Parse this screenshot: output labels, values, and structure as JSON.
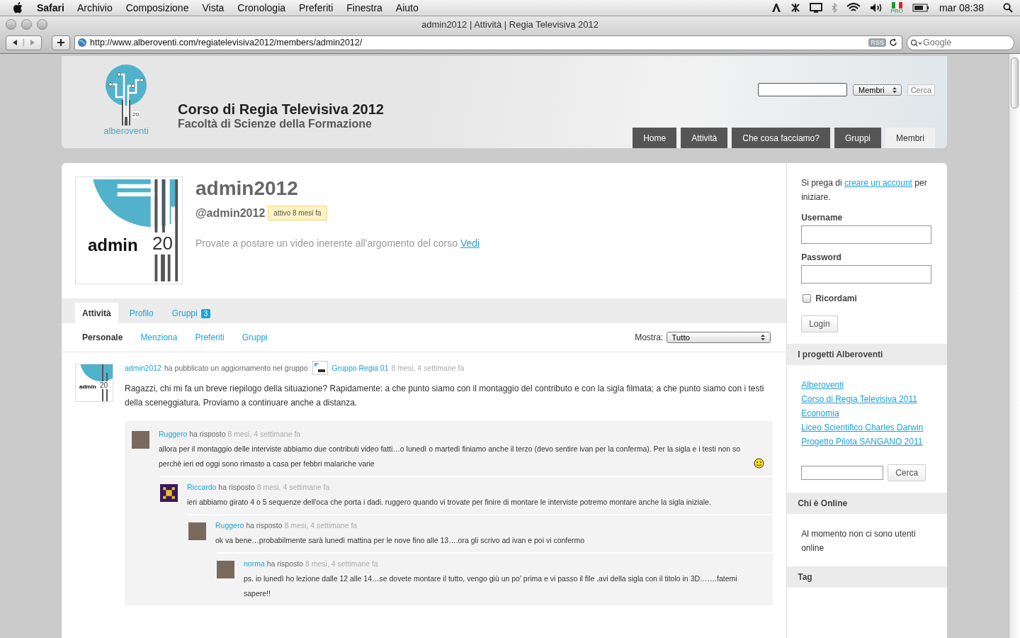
{
  "menubar": {
    "app": "Safari",
    "menus": [
      "Archivio",
      "Composizione",
      "Vista",
      "Cronologia",
      "Preferiti",
      "Finestra",
      "Aiuto"
    ],
    "flag_label": "PRO",
    "clock": "mar 08:38"
  },
  "window": {
    "title": "admin2012 | Attività | Regia Televisiva 2012"
  },
  "toolbar": {
    "url": "http://www.alberoventi.com/regiatelevisiva2012/members/admin2012/",
    "rss": "RSS",
    "search": {
      "placeholder": "Google"
    }
  },
  "site": {
    "logo_text": "alberoventi",
    "logo_year": "20",
    "title": "Corso di Regia Televisiva 2012",
    "subtitle": "Facoltà di Scienze della Formazione",
    "search_select": "Membri",
    "search_button": "Cerca",
    "nav": [
      {
        "label": "Home",
        "selected": false
      },
      {
        "label": "Attività",
        "selected": false
      },
      {
        "label": "Che cosa facciamo?",
        "selected": false
      },
      {
        "label": "Gruppi",
        "selected": false
      },
      {
        "label": "Membri",
        "selected": true
      }
    ]
  },
  "profile": {
    "avatar_text": "admin",
    "avatar_year": "20",
    "name": "admin2012",
    "handle": "@admin2012",
    "badge": "attivo 8 mesi fa",
    "status": "Provate a postare un video inerente all'argomento del corso",
    "status_link": "Vedi"
  },
  "tabs": [
    {
      "label": "Attività",
      "selected": true
    },
    {
      "label": "Profilo",
      "selected": false
    },
    {
      "label": "Gruppi",
      "count": "3",
      "selected": false
    }
  ],
  "subtabs": [
    {
      "label": "Personale",
      "selected": true
    },
    {
      "label": "Menziona",
      "selected": false
    },
    {
      "label": "Preferiti",
      "selected": false
    },
    {
      "label": "Gruppi",
      "selected": false
    }
  ],
  "filter": {
    "label": "Mostra:",
    "value": "Tutto"
  },
  "activity": {
    "avatar_text": "admin",
    "avatar_year": "20",
    "author": "admin2012",
    "action": "ha pubblicato un aggiornamento nel gruppo",
    "group": "Gruppo Regia 01",
    "time": "8 mesi, 4 settimane fa",
    "text": "Ragazzi, chi mi fa un breve riepilogo della situazione? Rapidamente: a che punto siamo con il montaggio del contributo e con la sigla filmata; a che punto siamo con i testi della sceneggiatura. Proviamo a continuare anche a distanza.",
    "replies": [
      {
        "author": "Ruggero",
        "kind": "photo",
        "action": "ha risposto",
        "time": "8 mesi, 4 settimane fa",
        "text": "allora per il montaggio delle interviste abbiamo due contributi video fatti…o lunedì o martedì finiamo anche il terzo (devo sentire ivan per la conferma). Per la sigla e i testi non so perchè ieri ed oggi sono rimasto a casa per febbri malariche varie",
        "smiley": true,
        "children": [
          {
            "author": "Riccardo",
            "kind": "pattern",
            "action": "ha risposto",
            "time": "8 mesi, 4 settimane fa",
            "text": "ieri abbiamo girato 4 o 5 sequenze dell'oca che porta i dadi. ruggero quando vi trovate per finire di montare le interviste potremo montare anche la sigla iniziale.",
            "children": [
              {
                "author": "Ruggero",
                "kind": "photo",
                "action": "ha risposto",
                "time": "8 mesi, 4 settimane fa",
                "text": "ok va bene…probabilmente sarà lunedì mattina per le nove fino alle 13….ora gli scrivo ad ivan e poi vi confermo",
                "children": [
                  {
                    "author": "norma",
                    "kind": "photo",
                    "action": "ha risposto",
                    "time": "8 mesi, 4 settimane fa",
                    "text": "ps. io lunedì ho lezione dalle 12 alle 14…se dovete montare il tutto, vengo giù un po' prima e vi passo il file .avi della sigla con il titolo in 3D…….fatemi sapere!!"
                  }
                ]
              }
            ]
          }
        ]
      }
    ]
  },
  "sidebar": {
    "intro_before": "Si prega di",
    "intro_link": "creare un account",
    "intro_after": "per iniziare.",
    "username_label": "Username",
    "password_label": "Password",
    "remember": {
      "label": "Ricordami",
      "checked": false
    },
    "login_button": "Login",
    "projects_title": "I progetti Alberoventi",
    "projects": [
      "Alberoventi",
      "Corso di Regia Televisiva 2011",
      "Economia",
      "Liceo Scientifico Charles Darwin",
      "Progetto Pilota SANGANO 2011"
    ],
    "search_button": "Cerca",
    "online_title": "Chi è Online",
    "online_text": "Al momento non ci sono utenti online",
    "tag_title": "Tag"
  }
}
